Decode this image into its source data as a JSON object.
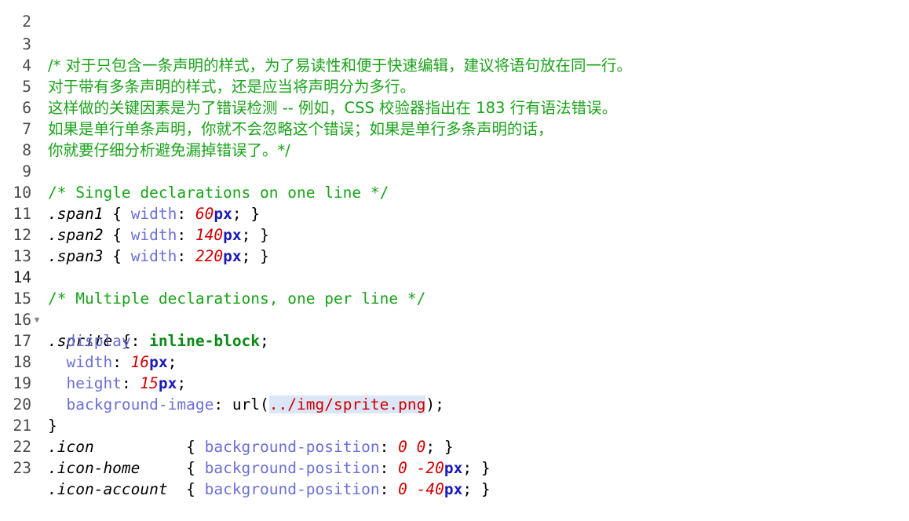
{
  "lines": [
    {
      "n": "2"
    },
    {
      "n": "3",
      "comment": "/* 对于只包含一条声明的样式，为了易读性和便于快速编辑，建议将语句放在同一行。"
    },
    {
      "n": "4",
      "comment": "对于带有多条声明的样式，还是应当将声明分为多行。"
    },
    {
      "n": "5",
      "comment": "这样做的关键因素是为了错误检测 -- 例如，CSS 校验器指出在 183 行有语法错误。"
    },
    {
      "n": "6",
      "comment": "如果是单行单条声明，你就不会忽略这个错误；如果是单行多条声明的话，"
    },
    {
      "n": "7",
      "comment": "你就要仔细分析避免漏掉错误了。*/"
    },
    {
      "n": "8"
    },
    {
      "n": "9",
      "comment": "/* Single declarations on one line */"
    },
    {
      "n": "10",
      "selector": ".span1",
      "prop": "width",
      "num": "60",
      "unit": "px"
    },
    {
      "n": "11",
      "selector": ".span2",
      "prop": "width",
      "num": "140",
      "unit": "px"
    },
    {
      "n": "12",
      "selector": ".span3",
      "prop": "width",
      "num": "220",
      "unit": "px"
    },
    {
      "n": "13"
    },
    {
      "n": "14",
      "comment": "/* Multiple declarations, one per line */"
    },
    {
      "n": "15",
      "selector": ".sprite",
      "open": "{"
    },
    {
      "n": "16",
      "prop": "display",
      "kw": "inline-block"
    },
    {
      "n": "17",
      "prop": "width",
      "num": "16",
      "unit": "px"
    },
    {
      "n": "18",
      "prop": "height",
      "num": "15",
      "unit": "px"
    },
    {
      "n": "19",
      "prop": "background-image",
      "fn": "url(",
      "str": "../img/sprite.png",
      "close_fn": ");"
    },
    {
      "n": "20",
      "close": "}"
    },
    {
      "n": "21",
      "selector": ".icon",
      "prop": "background-position",
      "num1": "0",
      "num2": "0"
    },
    {
      "n": "22",
      "selector": ".icon-home",
      "prop": "background-position",
      "num1": "0",
      "num2": "-20",
      "unit": "px"
    },
    {
      "n": "23",
      "selector": ".icon-account",
      "prop": "background-position",
      "num1": "0",
      "num2": "-40",
      "unit": "px"
    }
  ],
  "gutter": {
    "fold_glyph": "▼",
    "active_line": "14"
  },
  "colors": {
    "comment": "#1aa31a",
    "property": "#6b6fd6",
    "number": "#d20000",
    "unit": "#1a1ab8",
    "keyword": "#0c8a16",
    "selection": "#dbe6f7"
  }
}
